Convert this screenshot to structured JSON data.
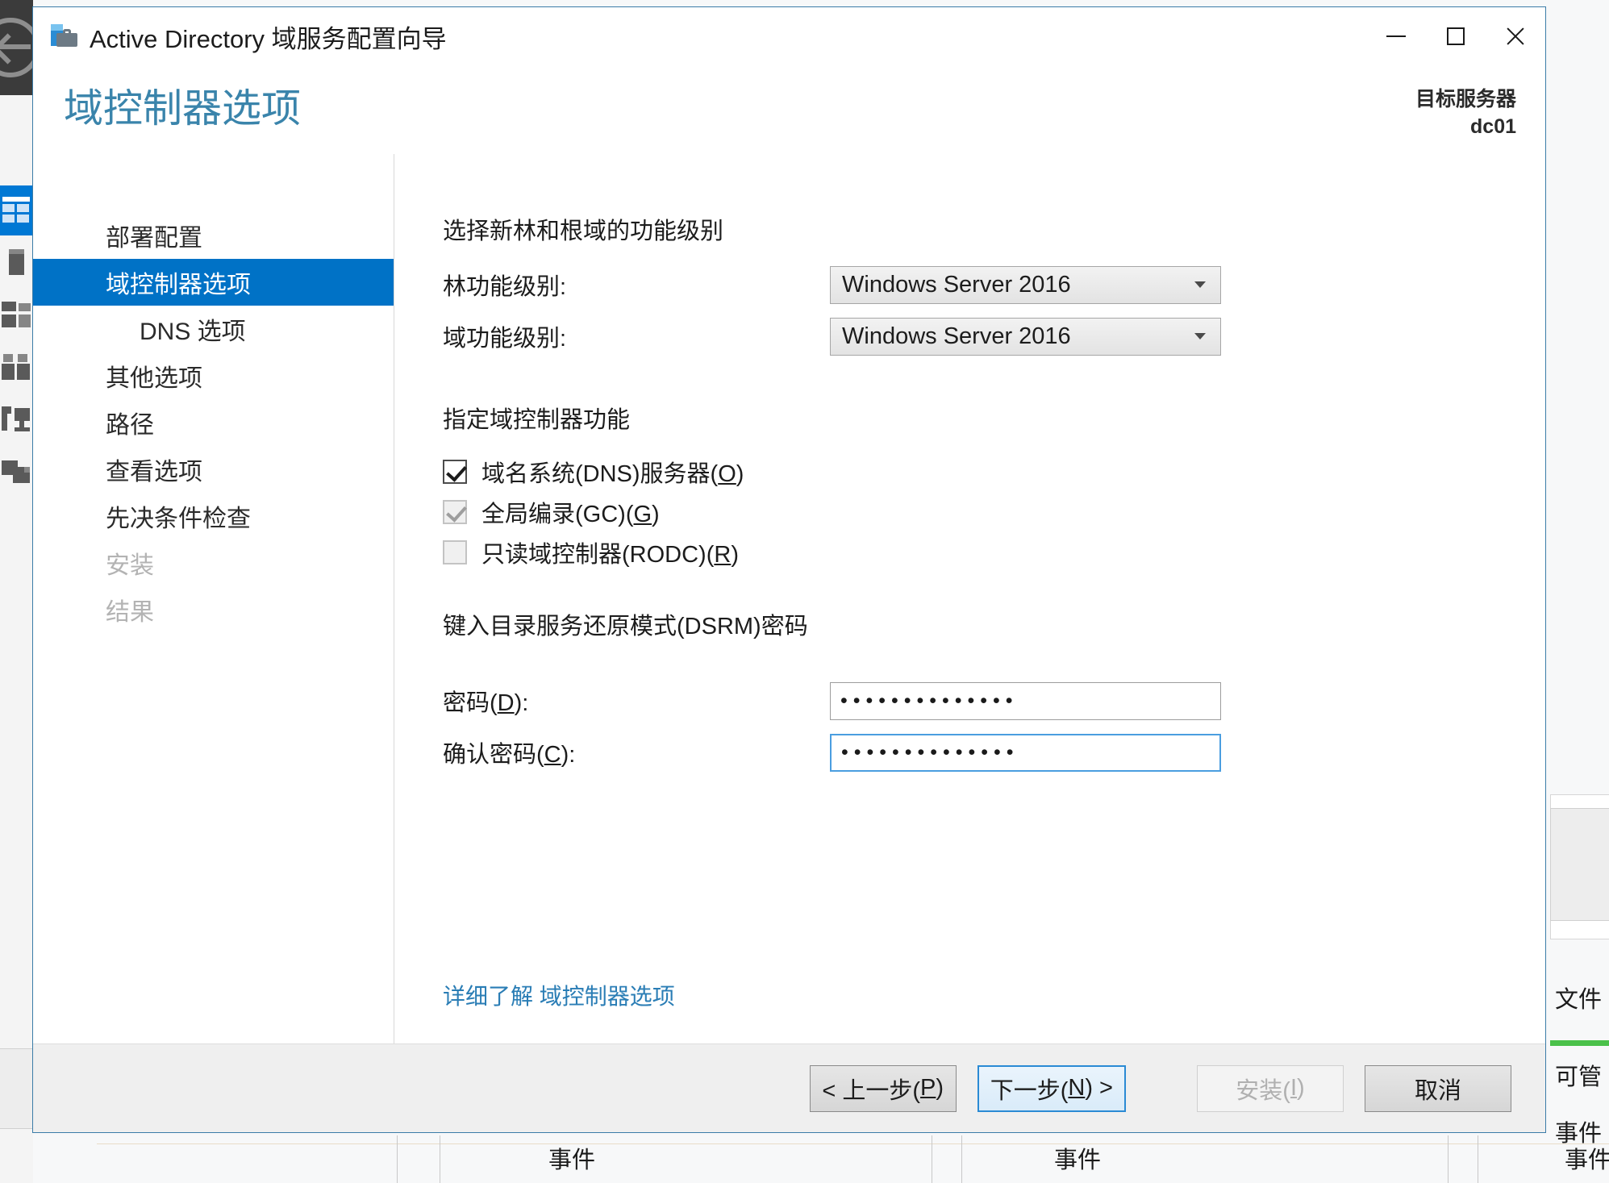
{
  "window": {
    "title": "Active Directory 域服务配置向导",
    "icon": "ad-wizard-icon",
    "controls": {
      "minimize": "—",
      "maximize": "□",
      "close": "✕"
    }
  },
  "header": {
    "page_title": "域控制器选项",
    "target_server_label": "目标服务器",
    "target_server_name": "dc01"
  },
  "nav": {
    "items": [
      {
        "label": "部署配置",
        "state": "normal",
        "indent": false
      },
      {
        "label": "域控制器选项",
        "state": "selected",
        "indent": false
      },
      {
        "label": "DNS 选项",
        "state": "normal",
        "indent": true
      },
      {
        "label": "其他选项",
        "state": "normal",
        "indent": false
      },
      {
        "label": "路径",
        "state": "normal",
        "indent": false
      },
      {
        "label": "查看选项",
        "state": "normal",
        "indent": false
      },
      {
        "label": "先决条件检查",
        "state": "normal",
        "indent": false
      },
      {
        "label": "安装",
        "state": "disabled",
        "indent": false
      },
      {
        "label": "结果",
        "state": "disabled",
        "indent": false
      }
    ]
  },
  "content": {
    "functional_level_heading": "选择新林和根域的功能级别",
    "forest_level_label": "林功能级别:",
    "forest_level_value": "Windows Server 2016",
    "domain_level_label": "域功能级别:",
    "domain_level_value": "Windows Server 2016",
    "capabilities_heading": "指定域控制器功能",
    "checkboxes": [
      {
        "label_pre": "域名系统(DNS)服务器(",
        "accel": "O",
        "label_post": ")",
        "checked": true,
        "disabled": false
      },
      {
        "label_pre": "全局编录(GC)(",
        "accel": "G",
        "label_post": ")",
        "checked": true,
        "disabled": true
      },
      {
        "label_pre": "只读域控制器(RODC)(",
        "accel": "R",
        "label_post": ")",
        "checked": false,
        "disabled": true
      }
    ],
    "dsrm_heading": "键入目录服务还原模式(DSRM)密码",
    "password_label_pre": "密码(",
    "password_label_accel": "D",
    "password_label_post": "):",
    "password_value": "••••••••••••••",
    "confirm_label_pre": "确认密码(",
    "confirm_label_accel": "C",
    "confirm_label_post": "):",
    "confirm_value": "••••••••••••••",
    "learn_more": "详细了解 域控制器选项"
  },
  "footer": {
    "previous": "< 上一步(P)",
    "previous_pre": "< 上一步(",
    "previous_accel": "P",
    "previous_post": ")",
    "next_pre": "下一步(",
    "next_accel": "N",
    "next_post": ") >",
    "install_pre": "安装(",
    "install_accel": "I",
    "install_post": ")",
    "cancel": "取消"
  },
  "background": {
    "tile_labels": [
      "事件",
      "事件",
      "事件"
    ],
    "right_labels": [
      "文件",
      "可管",
      "事件"
    ],
    "accent_green": "#4ac14a",
    "accent_blue": "#0078d4"
  }
}
